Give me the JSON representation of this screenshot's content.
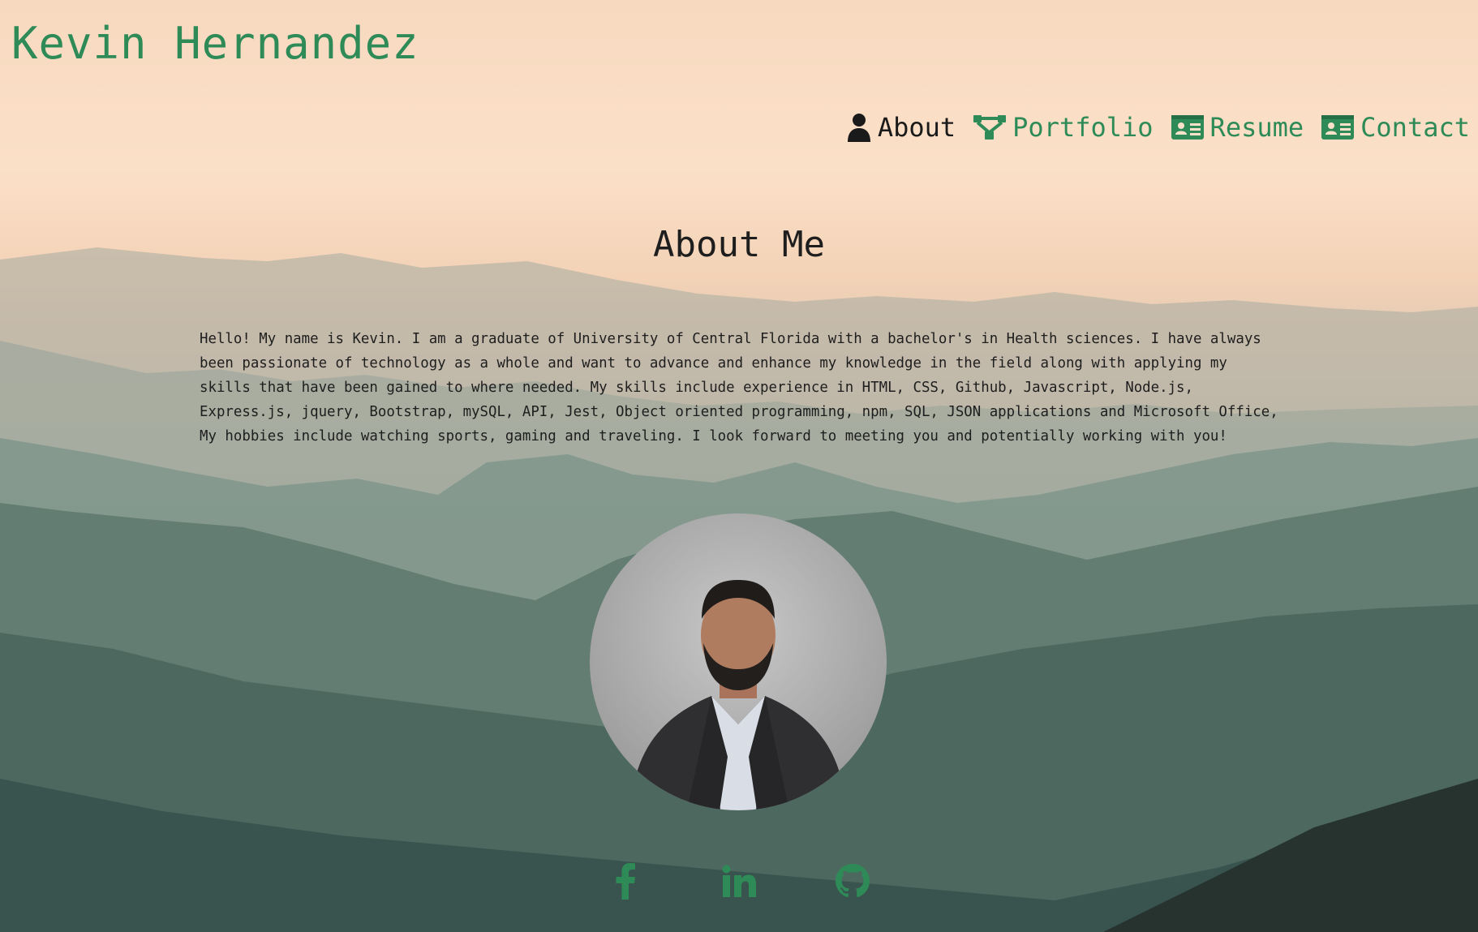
{
  "header": {
    "site_title": "Kevin Hernandez"
  },
  "nav": {
    "items": [
      {
        "label": "About",
        "icon": "user-icon",
        "active": true
      },
      {
        "label": "Portfolio",
        "icon": "sitemap-icon",
        "active": false
      },
      {
        "label": "Resume",
        "icon": "id-card-icon",
        "active": false
      },
      {
        "label": "Contact",
        "icon": "id-card-icon",
        "active": false
      }
    ]
  },
  "about": {
    "title": "About Me",
    "body": "Hello! My name is Kevin. I am a graduate of University of Central Florida with a bachelor's in Health sciences. I have always been passionate of technology as a whole and want to advance and enhance my knowledge in the field along with applying my skills that have been gained to where needed. My skills include experience in HTML, CSS, Github, Javascript, Node.js, Express.js, jquery, Bootstrap, mySQL, API, Jest, Object oriented programming, npm, SQL, JSON applications and Microsoft Office, My hobbies include watching sports, gaming and traveling. I look forward to meeting you and potentially working with you!"
  },
  "social": [
    {
      "icon": "facebook-icon"
    },
    {
      "icon": "linkedin-icon"
    },
    {
      "icon": "github-icon"
    }
  ],
  "colors": {
    "accent": "#2e8b57",
    "text": "#1e1e1e",
    "sky": "#f7d9bf",
    "mountain_dark": "#2f4a45"
  }
}
